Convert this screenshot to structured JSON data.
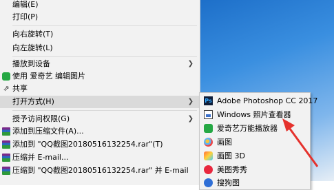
{
  "context_menu": {
    "items": [
      {
        "label": "编辑(E)",
        "icon": ""
      },
      {
        "label": "打印(P)",
        "icon": ""
      },
      {
        "label": "向右旋转(T)",
        "icon": ""
      },
      {
        "label": "向左旋转(L)",
        "icon": ""
      },
      {
        "label": "播放到设备",
        "icon": "",
        "submenu": true
      },
      {
        "label": "使用 爱奇艺 编辑图片",
        "icon": "iqiyi-icon"
      },
      {
        "label": "共享",
        "icon": "share-icon"
      },
      {
        "label": "打开方式(H)",
        "icon": "",
        "submenu": true,
        "highlighted": true
      },
      {
        "label": "授予访问权限(G)",
        "icon": "",
        "submenu": true
      },
      {
        "label": "添加到压缩文件(A)...",
        "icon": "winrar-icon"
      },
      {
        "label": "添加到 \"QQ截图20180516132254.rar\"(T)",
        "icon": "winrar-icon"
      },
      {
        "label": "压缩并 E-mail...",
        "icon": "winrar-icon"
      },
      {
        "label": "压缩到 \"QQ截图20180516132254.rar\" 并 E-mail",
        "icon": "winrar-icon"
      }
    ]
  },
  "open_with_submenu": {
    "items": [
      {
        "label": "Adobe Photoshop CC 2017",
        "icon": "photoshop-icon"
      },
      {
        "label": "Windows 照片查看器",
        "icon": "photo-viewer-icon"
      },
      {
        "label": "爱奇艺万能播放器",
        "icon": "iqiyi-player-icon"
      },
      {
        "label": "画图",
        "icon": "paint-icon"
      },
      {
        "label": "画图 3D",
        "icon": "paint-3d-icon"
      },
      {
        "label": "美图秀秀",
        "icon": "meitu-icon"
      },
      {
        "label": "搜狗图",
        "icon": "sogou-icon"
      }
    ]
  },
  "colors": {
    "annotation_arrow": "#e5322d",
    "menu_bg": "#f2f2f2",
    "highlight": "#dadada"
  }
}
